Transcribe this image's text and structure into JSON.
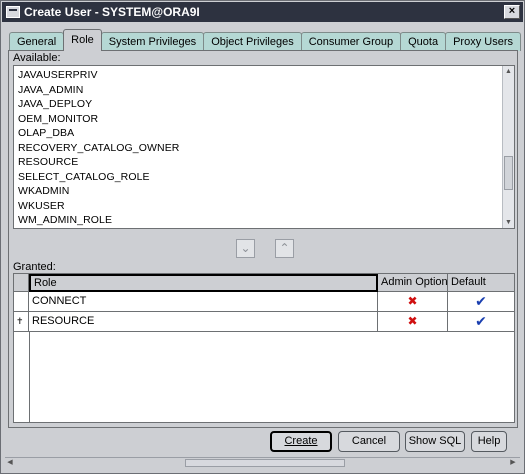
{
  "window": {
    "title": "Create User - SYSTEM@ORA9I"
  },
  "tabs": [
    {
      "label": "General",
      "active": false
    },
    {
      "label": "Role",
      "active": true
    },
    {
      "label": "System Privileges",
      "active": false
    },
    {
      "label": "Object Privileges",
      "active": false
    },
    {
      "label": "Consumer Group",
      "active": false
    },
    {
      "label": "Quota",
      "active": false
    },
    {
      "label": "Proxy Users",
      "active": false
    }
  ],
  "available": {
    "label": "Available:",
    "items": [
      "JAVAUSERPRIV",
      "JAVA_ADMIN",
      "JAVA_DEPLOY",
      "OEM_MONITOR",
      "OLAP_DBA",
      "RECOVERY_CATALOG_OWNER",
      "RESOURCE",
      "SELECT_CATALOG_ROLE",
      "WKADMIN",
      "WKUSER",
      "WM_ADMIN_ROLE"
    ]
  },
  "move_buttons": {
    "down_icon": "chevron-down-icon",
    "up_icon": "chevron-up-icon"
  },
  "granted": {
    "label": "Granted:",
    "columns": [
      "Role",
      "Admin Option",
      "Default"
    ],
    "rows": [
      {
        "role": "CONNECT",
        "admin_option": "✖",
        "default": "✔",
        "current": false
      },
      {
        "role": "RESOURCE",
        "admin_option": "✖",
        "default": "✔",
        "current": true
      }
    ]
  },
  "buttons": {
    "create": "Create",
    "cancel": "Cancel",
    "show_sql": "Show SQL",
    "help": "Help"
  },
  "colors": {
    "title_bar": "#2d3240",
    "tab_inactive": "#b5d8d4",
    "dialog_bg": "#cdcfd3",
    "x_mark": "#d01010",
    "check_mark": "#1a3fb0"
  }
}
